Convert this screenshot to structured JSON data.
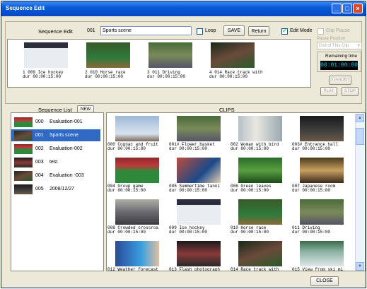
{
  "window": {
    "title": "Sequence Edit"
  },
  "colors": {
    "titlebar": "#0a5ad8",
    "selection": "#316ac5",
    "remaining_bg": "#000000",
    "remaining_fg": "#00d0ff"
  },
  "edit": {
    "label": "Sequence Edit",
    "number": "001",
    "name": "Sports scene",
    "loop_label": "Loop",
    "loop_checked": false,
    "save_label": "SAVE",
    "return_label": "Return",
    "edit_mode_label": "Edit Mode",
    "edit_mode_checked": true
  },
  "timeline": [
    {
      "num": "1",
      "id": "009",
      "name": "Ice hockey",
      "dur": "00:00:15:00",
      "thumb": "ice-hockey"
    },
    {
      "num": "2",
      "id": "010",
      "name": "Horse race",
      "dur": "00:00:15:00",
      "thumb": "horse-race"
    },
    {
      "num": "3",
      "id": "011",
      "name": "Driving",
      "dur": "00:00:15:00",
      "thumb": "driving"
    },
    {
      "num": "4",
      "id": "014",
      "name": "Race track with",
      "dur": "00:00:15:00",
      "thumb": "race-track"
    }
  ],
  "right": {
    "clip_pause_label": "Clip Pause",
    "pause_position_label": "Pause Position",
    "pause_position_value": "End of This Clip",
    "remaining_label": "Remaining time",
    "remaining_value": "00:01:00:00",
    "standby_label": "STANDBY",
    "play_label": "PLAY",
    "stop_label": "STOP"
  },
  "sequence_list": {
    "label": "Sequence List",
    "new_label": "NEW",
    "items": [
      {
        "id": "000",
        "name": "Evaluation-001",
        "selected": false
      },
      {
        "id": "001",
        "name": "Sports scene",
        "selected": true
      },
      {
        "id": "002",
        "name": "Evaluation-002",
        "selected": false
      },
      {
        "id": "003",
        "name": "test",
        "selected": false
      },
      {
        "id": "004",
        "name": "Evaluation -003",
        "selected": false
      },
      {
        "id": "005",
        "name": "2008/12/27",
        "selected": false
      }
    ]
  },
  "clips": {
    "label": "CLIPS",
    "items": [
      {
        "id": "000",
        "name": "Cognac and fruit",
        "dur": "00:00:15:00",
        "thumb": "cognac"
      },
      {
        "id": "001#",
        "name": "Flower basket",
        "dur": "00:00:15:00",
        "thumb": "driving"
      },
      {
        "id": "002",
        "name": "Woman with bird",
        "dur": "00:00:15:00",
        "thumb": "buildings"
      },
      {
        "id": "003#",
        "name": "Entrance hall",
        "dur": "00:00:15:00",
        "thumb": "hall"
      },
      {
        "id": "004",
        "name": "Group game",
        "dur": "00:00:15:00",
        "thumb": "stadium"
      },
      {
        "id": "005",
        "name": "Summertime tanni",
        "dur": "00:00:15:00",
        "thumb": "tennis"
      },
      {
        "id": "006",
        "name": "Green leaves",
        "dur": "00:00:15:00",
        "thumb": "leaves"
      },
      {
        "id": "007",
        "name": "Japanese room",
        "dur": "00:00:15:00",
        "thumb": "room"
      },
      {
        "id": "008",
        "name": "Crowded crossroa",
        "dur": "00:00:15:00",
        "thumb": "crowd"
      },
      {
        "id": "009",
        "name": "Ice hockey",
        "dur": "00:00:15:00",
        "thumb": "ice-hockey"
      },
      {
        "id": "010",
        "name": "Horse race",
        "dur": "00:00:15:00",
        "thumb": "horse-race"
      },
      {
        "id": "011",
        "name": "Driving",
        "dur": "00:00:15:00",
        "thumb": "driving"
      },
      {
        "id": "012",
        "name": "Weather forecast",
        "dur": "",
        "thumb": "weather"
      },
      {
        "id": "013",
        "name": "Flash photograph",
        "dur": "",
        "thumb": "flash"
      },
      {
        "id": "014",
        "name": "Race track with",
        "dur": "",
        "thumb": "race-track"
      },
      {
        "id": "015",
        "name": "View from ski mi",
        "dur": "",
        "thumb": "ski"
      }
    ]
  },
  "footer": {
    "close_label": "CLOSE"
  }
}
